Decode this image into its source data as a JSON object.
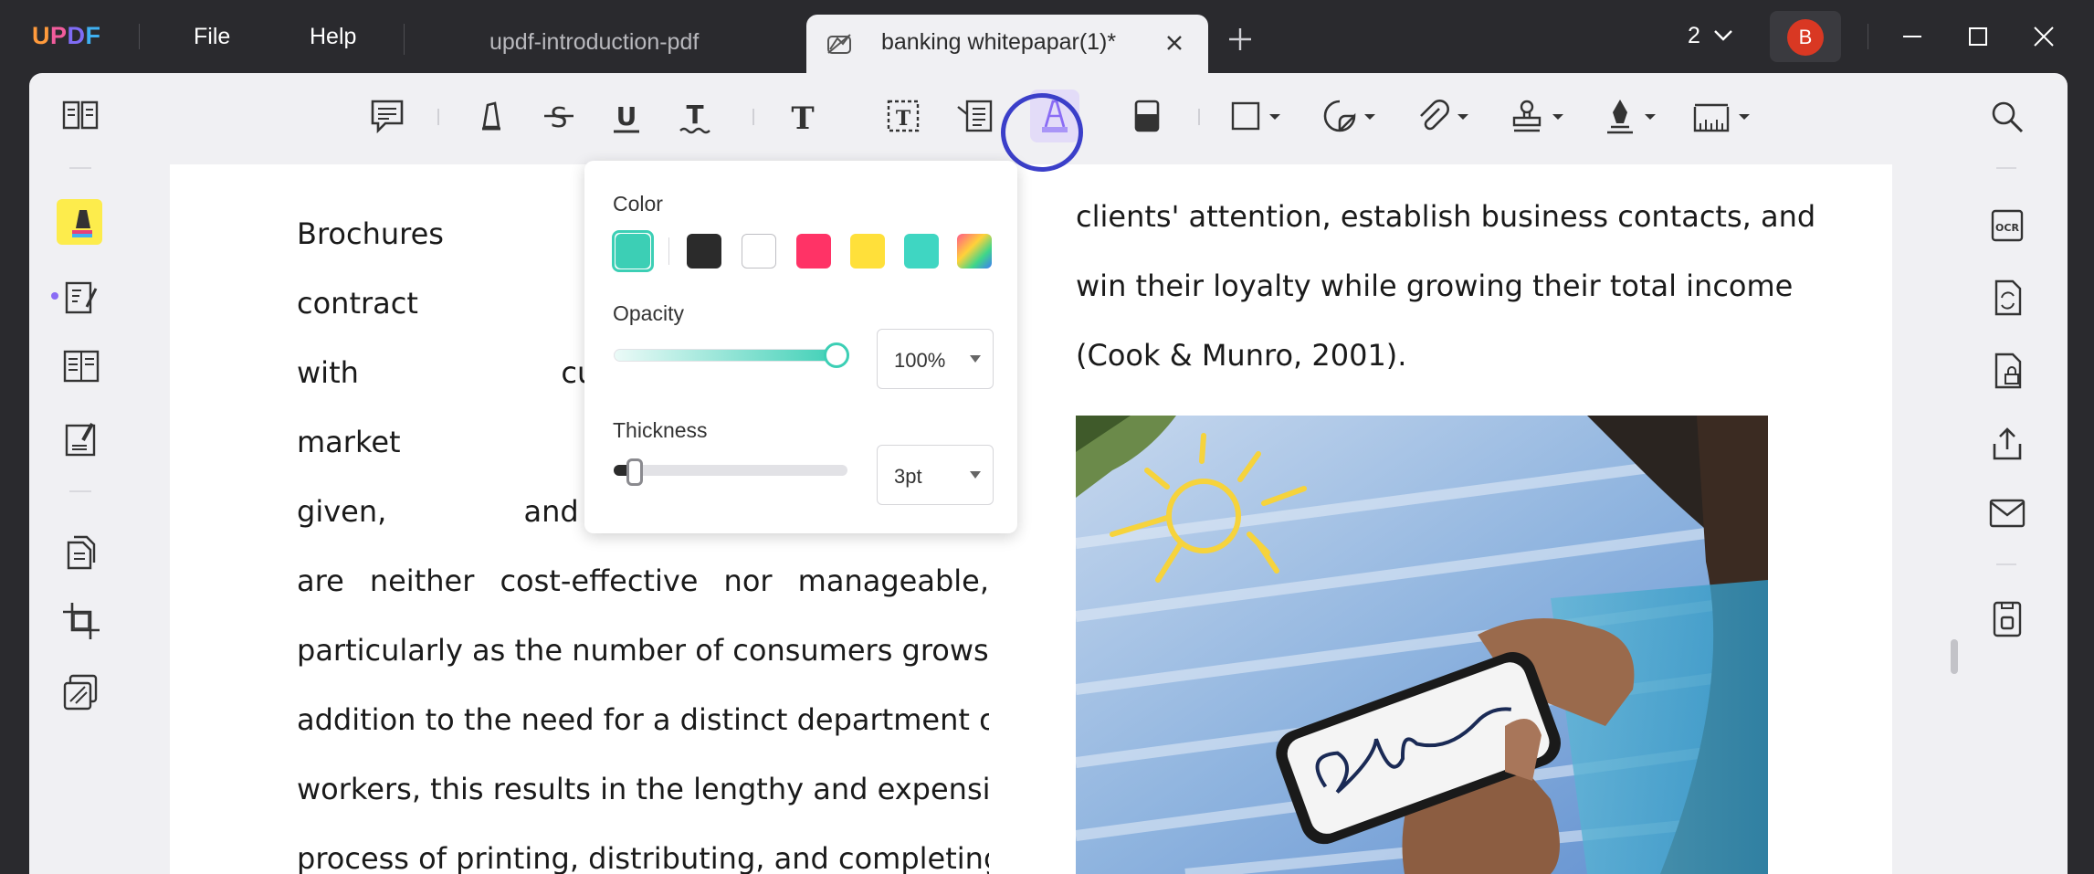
{
  "app": {
    "logo": {
      "u": "U",
      "p": "P",
      "d": "D",
      "f": "F"
    },
    "menu": {
      "file": "File",
      "help": "Help"
    },
    "tabs": {
      "inactive": "updf-introduction-pdf",
      "active": "banking whitepapar(1)*"
    },
    "page_selector": "2",
    "avatar_initial": "B"
  },
  "popup": {
    "color_label": "Color",
    "opacity_label": "Opacity",
    "opacity_value": "100%",
    "opacity_level": 1.0,
    "thickness_label": "Thickness",
    "thickness_value": "3pt",
    "thickness_level": 0.1,
    "swatches": [
      "#3ccfb5",
      "#2b2b2b",
      "#ffffff",
      "#ff3366",
      "#ffe03a",
      "#3fd6c2",
      "gradient"
    ],
    "selected_color": "#3ccfb5"
  },
  "document": {
    "left_lines": [
      "Brochures and new",
      "contract agreement",
      "with customers abou",
      "market growth for",
      "given, and several ot",
      "are neither cost-effective nor manageable,",
      "particularly as the number of consumers grows. In",
      "addition to the need for a distinct department of",
      "workers, this results in the lengthy and expensive",
      "process of printing, distributing, and completing"
    ],
    "right_lines": [
      "clients' attention, establish business contacts, and",
      "win their loyalty while growing their total income",
      "(Cook & Munro, 2001)."
    ]
  },
  "colors": {
    "accent": "#3b3fc9",
    "active_tool": "#8a6cf5",
    "teal": "#3ccfb5"
  }
}
